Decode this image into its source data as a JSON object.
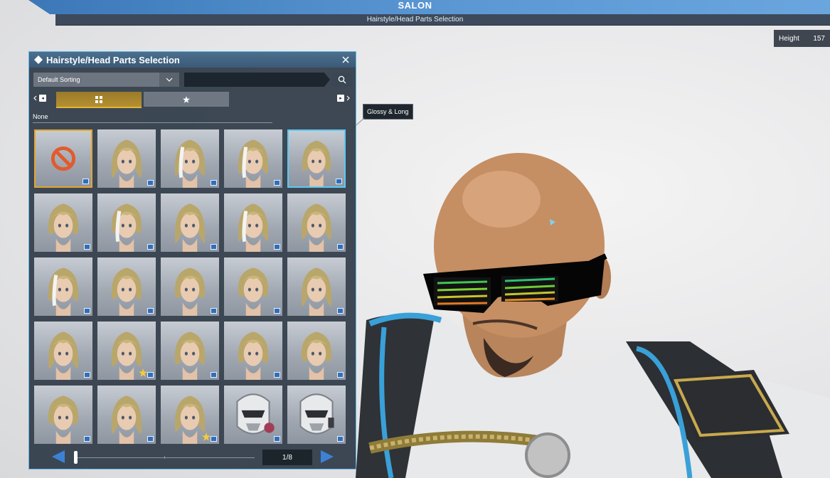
{
  "header": {
    "title": "SALON",
    "subtitle": "Hairstyle/Head Parts Selection"
  },
  "height": {
    "label": "Height",
    "value": "157"
  },
  "panel": {
    "title": "Hairstyle/Head Parts Selection",
    "sort": {
      "selected": "Default Sorting"
    },
    "search": {
      "value": "",
      "placeholder": ""
    },
    "nav_left_key": "◂",
    "nav_right_key": "▸",
    "selected_name": "None",
    "page": "1/8"
  },
  "tooltip": "Glossy & Long",
  "grid_items": [
    {
      "type": "none",
      "selected": "none",
      "star": false
    },
    {
      "type": "hair",
      "variant": "short-messy",
      "star": false
    },
    {
      "type": "hair",
      "variant": "swept-white-streak",
      "star": false
    },
    {
      "type": "hair",
      "variant": "long-white-clip",
      "star": false
    },
    {
      "type": "hair",
      "variant": "glossy-long",
      "selected": "current",
      "star": false
    },
    {
      "type": "hair",
      "variant": "short-bob",
      "star": false
    },
    {
      "type": "hair",
      "variant": "hime-white-tips",
      "star": false
    },
    {
      "type": "hair",
      "variant": "angular-bob",
      "star": false
    },
    {
      "type": "hair",
      "variant": "long-white-streak",
      "star": false
    },
    {
      "type": "hair",
      "variant": "rounded-bob",
      "star": false
    },
    {
      "type": "hair",
      "variant": "white-bangs",
      "star": false
    },
    {
      "type": "hair",
      "variant": "high-ponytail",
      "star": false
    },
    {
      "type": "hair",
      "variant": "short-layered",
      "star": false
    },
    {
      "type": "hair",
      "variant": "parted-short",
      "star": false
    },
    {
      "type": "hair",
      "variant": "long-straight",
      "star": false
    },
    {
      "type": "hair",
      "variant": "side-bun",
      "star": false
    },
    {
      "type": "hair",
      "variant": "bob-fav",
      "star": true
    },
    {
      "type": "hair",
      "variant": "wavy-short",
      "star": false
    },
    {
      "type": "hair",
      "variant": "spiky-messy",
      "star": false
    },
    {
      "type": "hair",
      "variant": "long-ponytail",
      "star": false
    },
    {
      "type": "hair",
      "variant": "headband-updo",
      "star": false
    },
    {
      "type": "hair",
      "variant": "wavy-bob",
      "star": false
    },
    {
      "type": "hair",
      "variant": "bob-fav-2",
      "star": true
    },
    {
      "type": "mask",
      "variant": "mech-helmet-red",
      "star": false
    },
    {
      "type": "mask",
      "variant": "mech-helmet-white",
      "star": false
    }
  ],
  "colors": {
    "accent": "#5fb6e8",
    "tab_active": "#b58f30",
    "panel_bg": "#2e3a46",
    "none_icon": "#e35a2c"
  }
}
